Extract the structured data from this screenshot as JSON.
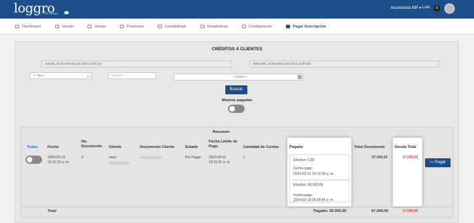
{
  "brand": {
    "logo": "loggro",
    "sub": "POS Tienda"
  },
  "header": {
    "account": "Accesorios MP",
    "account_caret": "▾",
    "user": "Luis",
    "notif": "0"
  },
  "menu": [
    {
      "label": "Dashboard"
    },
    {
      "label": "Vender"
    },
    {
      "label": "Ventas"
    },
    {
      "label": "Productos"
    },
    {
      "label": "Contabilidad"
    },
    {
      "label": "Estadísticas"
    },
    {
      "label": "Configuración"
    },
    {
      "label": "Pagar Suscripción"
    }
  ],
  "page": {
    "title": "CRÉDITOS A CLIENTES"
  },
  "filters": {
    "date_from": "Jueves, 15 de Febrero de 2024 12:00 am",
    "date_to": "Miércoles, 20 de Marzo de 2024 12:00 am",
    "tipo": "--- Tipo ---",
    "numero_placeholder": "Número",
    "cliente": "--- Cliente ---",
    "buscar": "Buscar",
    "mostrar_pagadas": "Mostrar pagadas"
  },
  "table": {
    "resumen": "Resumen",
    "headers": {
      "todas": "Todas",
      "fecha": "Fecha",
      "no_doc": "No. Documento",
      "cliente": "Cliente",
      "doc_cliente": "Documento Cliente",
      "estado": "Estado",
      "fecha_limite": "Fecha Límite de Pago",
      "cuotas": "Cantidad de Cuotas",
      "pagado": "Pagado",
      "total_doc": "Total Documento",
      "deuda": "Deuda Total"
    },
    "row": {
      "fecha": "2024-03-12 10:11:23 a. m.",
      "no_doc": "3",
      "cliente": "mary",
      "estado": "Por Pagar",
      "fecha_limite": "2024-04-11 10:11:31 a. m.",
      "cuotas": "1",
      "pagos": [
        {
          "efectivo": "Efectivo: 0,00",
          "fecha_label": "Fecha pago:",
          "fecha": "2024-03-12 10:10:29 a. m."
        },
        {
          "efectivo": "Efectivo: 50.000,00",
          "fecha_label": "Fecha pago:",
          "fecha": "2024-03-19 05:58:45 p. m."
        }
      ],
      "total_doc": "67.000,00",
      "deuda": "17.000,00",
      "pagar": "Pagar"
    },
    "total": {
      "label": "Total",
      "pagado": "Pagado: 50.000,00",
      "total_doc": "67.000,00",
      "deuda": "17.000,00"
    }
  },
  "colors": {
    "primary": "#1d4e89",
    "debt": "#e53935"
  }
}
